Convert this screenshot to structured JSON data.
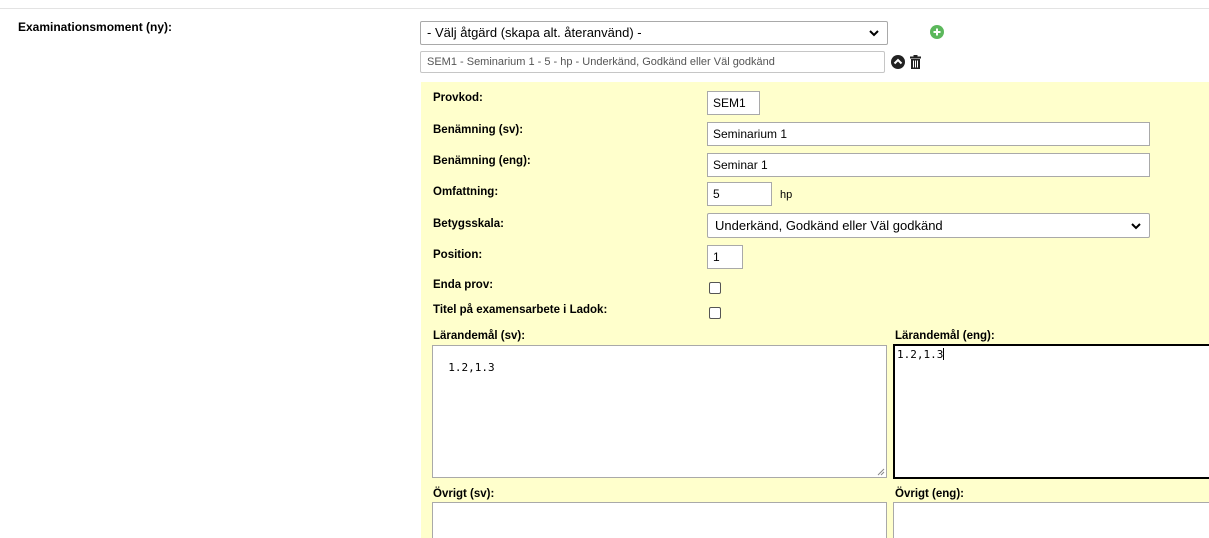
{
  "section": {
    "label": "Examinationsmoment (ny):"
  },
  "action_select": {
    "value": "- Välj åtgärd (skapa alt. återanvänd) -"
  },
  "summary": {
    "value": "SEM1 - Seminarium 1 - 5 - hp - Underkänd, Godkänd eller Väl godkänd"
  },
  "form": {
    "provkod": {
      "label": "Provkod:",
      "value": "SEM1"
    },
    "benamning_sv": {
      "label": "Benämning (sv):",
      "value": "Seminarium 1"
    },
    "benamning_eng": {
      "label": "Benämning (eng):",
      "value": "Seminar 1"
    },
    "omfattning": {
      "label": "Omfattning:",
      "value": "5",
      "unit": "hp"
    },
    "betygsskala": {
      "label": "Betygsskala:",
      "value": "Underkänd, Godkänd eller Väl godkänd"
    },
    "position": {
      "label": "Position:",
      "value": "1"
    },
    "enda_prov": {
      "label": "Enda prov:",
      "checked": false
    },
    "titel_examensarbete": {
      "label": "Titel på examensarbete i Ladok:",
      "checked": false
    },
    "larandemal_sv": {
      "label": "Lärandemål (sv):",
      "value": "1.2,1.3"
    },
    "larandemal_eng": {
      "label": "Lärandemål (eng):",
      "value": "1.2,1.3"
    },
    "ovrigt_sv": {
      "label": "Övrigt (sv):",
      "value": ""
    },
    "ovrigt_eng": {
      "label": "Övrigt (eng):",
      "value": ""
    }
  },
  "colors": {
    "panel_bg": "#ffffcc",
    "add_icon": "#5cb85c",
    "focus_border": "#000000"
  },
  "icons": [
    "chevron-down-icon",
    "add-circle-icon",
    "collapse-up-icon",
    "trash-icon"
  ]
}
